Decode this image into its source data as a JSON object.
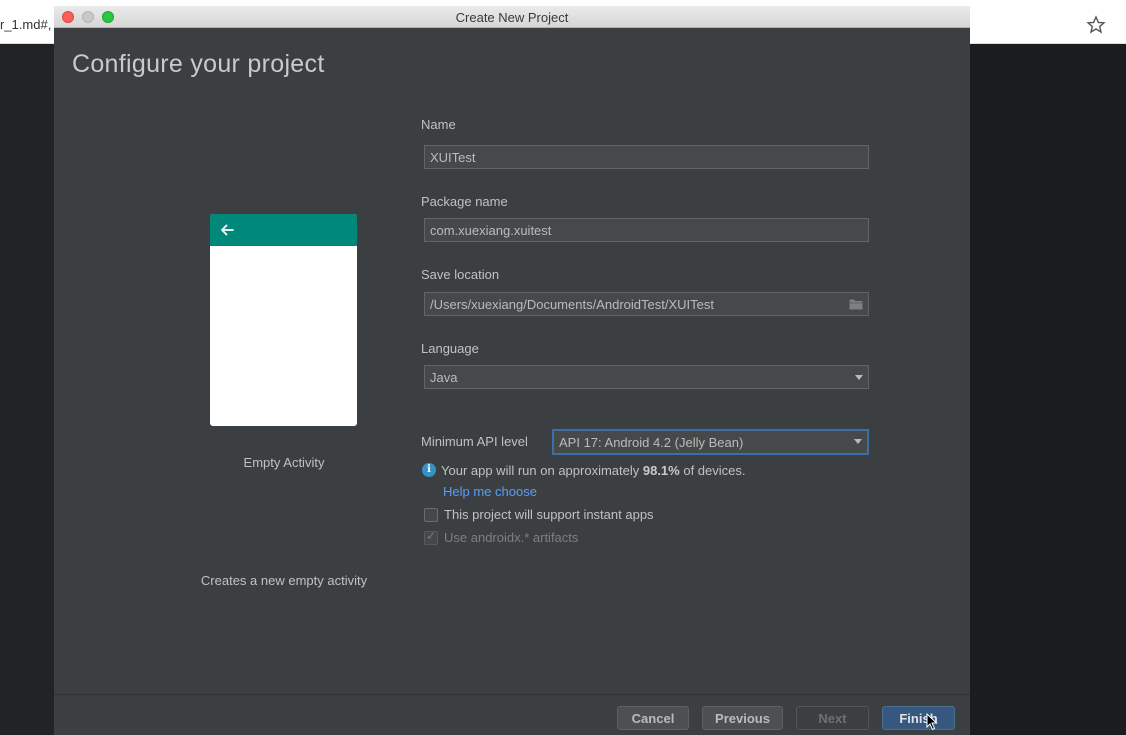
{
  "browser": {
    "tab_text": "r_1.md#,",
    "star_icon": "star-icon"
  },
  "dialog": {
    "title": "Create New Project",
    "header": "Configure your project"
  },
  "template": {
    "name": "Empty Activity",
    "description": "Creates a new empty activity",
    "accent_color": "#00897b"
  },
  "form": {
    "name_label": "Name",
    "name_value": "XUITest",
    "package_label": "Package name",
    "package_value": "com.xuexiang.xuitest",
    "location_label": "Save location",
    "location_value": "/Users/xuexiang/Documents/AndroidTest/XUITest",
    "language_label": "Language",
    "language_value": "Java",
    "api_label": "Minimum API level",
    "api_value": "API 17: Android 4.2 (Jelly Bean)",
    "info_prefix": "Your app will run on approximately ",
    "info_percent": "98.1%",
    "info_suffix": " of devices.",
    "help_link": "Help me choose",
    "instant_apps_label": "This project will support instant apps",
    "instant_apps_checked": false,
    "androidx_label": "Use androidx.* artifacts",
    "androidx_checked": true
  },
  "buttons": {
    "cancel": "Cancel",
    "previous": "Previous",
    "next": "Next",
    "finish": "Finish"
  },
  "colors": {
    "dialog_bg": "#3c3f41",
    "link": "#589df6",
    "primary_button": "#365880",
    "focus_border": "#3d6ea8"
  }
}
